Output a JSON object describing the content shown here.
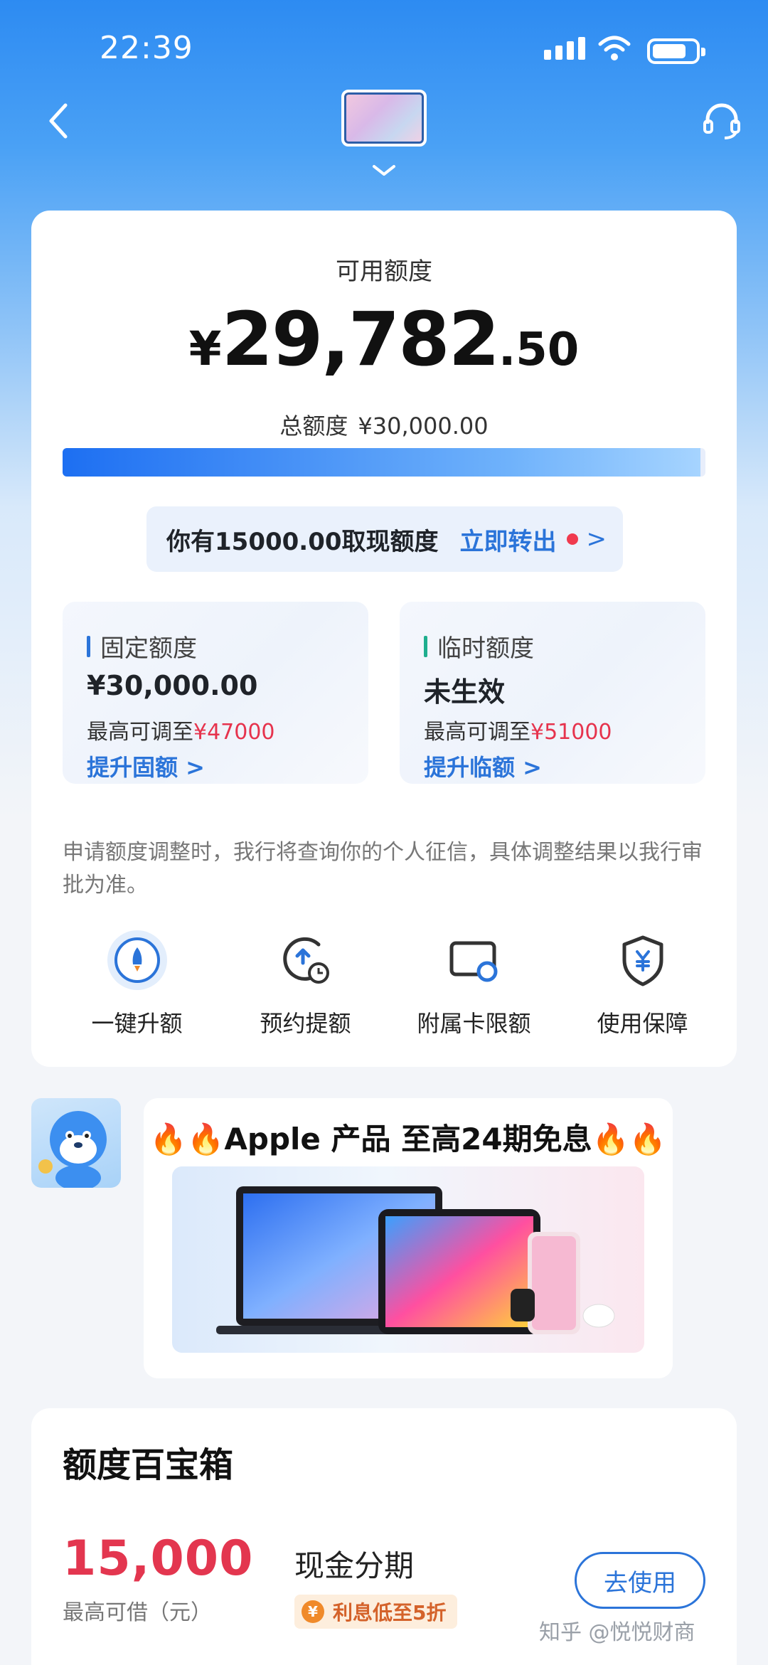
{
  "status_bar": {
    "time": "22:39"
  },
  "credit": {
    "available_label": "可用额度",
    "currency": "¥",
    "available_int": "29,782",
    "available_dec": ".50",
    "total_label": "总额度",
    "total_value": "¥30,000.00",
    "usage_fraction": 0.9928,
    "cash_text": "你有15000.00取现额度",
    "cash_action": "立即转出",
    "fixed": {
      "title": "固定额度",
      "value": "¥30,000.00",
      "max_prefix": "最高可调至",
      "max_value": "¥47000",
      "link": "提升固额"
    },
    "temporary": {
      "title": "临时额度",
      "value": "未生效",
      "max_prefix": "最高可调至",
      "max_value": "¥51000",
      "link": "提升临额"
    },
    "note": "申请额度调整时，我行将查询你的个人征信，具体调整结果以我行审批为准。",
    "actions": [
      {
        "label": "一键升额",
        "icon": "rocket-icon"
      },
      {
        "label": "预约提额",
        "icon": "clock-upload-icon"
      },
      {
        "label": "附属卡限额",
        "icon": "card-link-icon"
      },
      {
        "label": "使用保障",
        "icon": "yen-shield-icon"
      }
    ]
  },
  "promo": {
    "title": "🔥🔥Apple 产品 至高24期免息🔥🔥"
  },
  "treasure_box": {
    "title": "额度百宝箱",
    "amount": "15,000",
    "amount_label": "最高可借（元）",
    "product": "现金分期",
    "tag": "利息低至5折",
    "button": "去使用"
  },
  "watermark": "知乎 @悦悦财商",
  "colors": {
    "accent": "#2b74d9",
    "red": "#e3364f"
  }
}
